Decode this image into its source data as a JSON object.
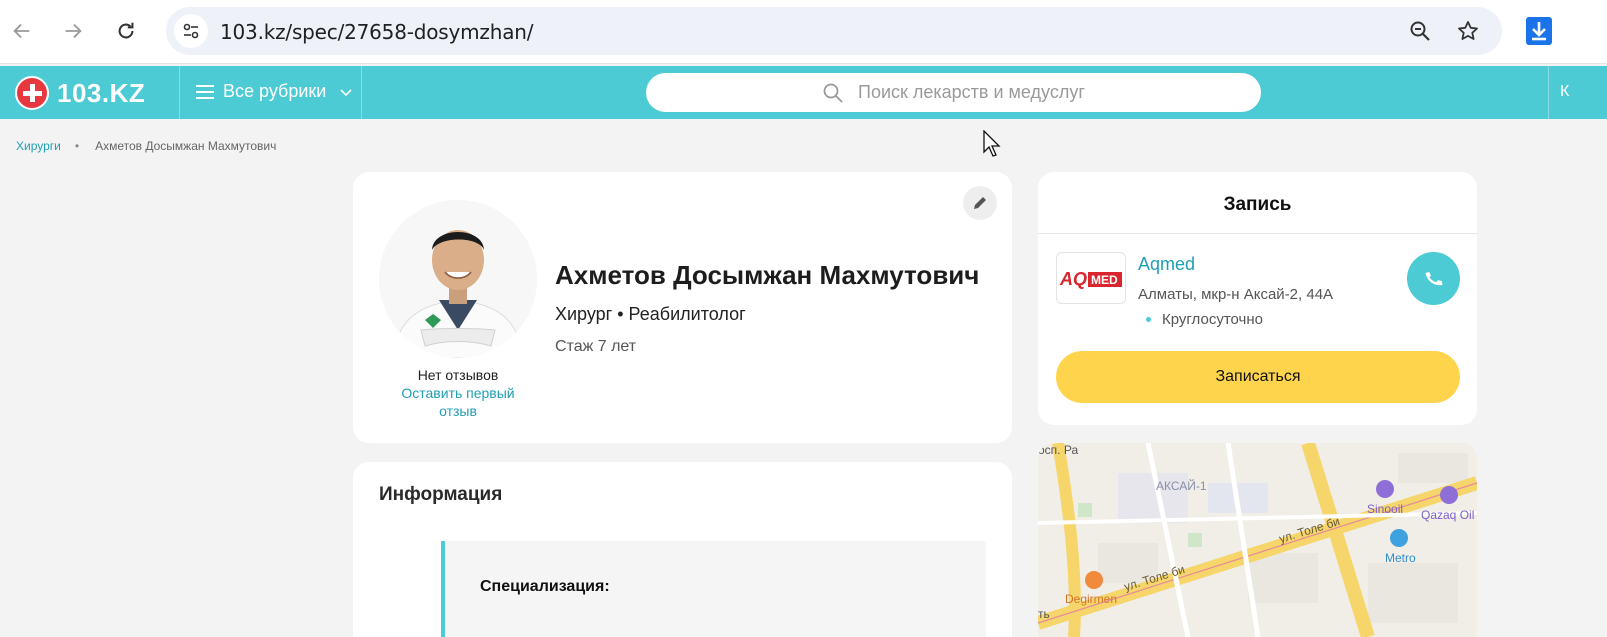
{
  "browser": {
    "url": "103.kz/spec/27658-dosymzhan/"
  },
  "header": {
    "logo_text": "103.KZ",
    "rubrics_label": "Все рубрики",
    "search_placeholder": "Поиск лекарств и медуслуг",
    "cut_text": "К"
  },
  "breadcrumb": {
    "parent": "Хирурги",
    "current": "Ахметов Досымжан Махмутович"
  },
  "doctor": {
    "name": "Ахметов Досымжан Махмутович",
    "specialties": "Хирург • Реабилитолог",
    "experience": "Стаж 7 лет",
    "no_reviews": "Нет отзывов",
    "leave_review": "Оставить первый отзыв"
  },
  "info": {
    "title": "Информация",
    "specialization_label": "Специализация:"
  },
  "booking": {
    "title": "Запись",
    "clinic_logo_text": "AQMED",
    "clinic_name": "Aqmed",
    "address": "Алматы, мкр-н Аксай-2, 44А",
    "hours": "Круглосуточно",
    "book_button": "Записаться"
  },
  "map": {
    "labels": {
      "district": "АКСАЙ-1",
      "street1": "ул. Толе би",
      "street2": "ул. Толе би",
      "poi_sinooil": "Sinooil",
      "poi_qazaq": "Qazaq Oil",
      "poi_metro": "Metro",
      "poi_degirmen": "Degirmen",
      "corner_top": "осп. Ра",
      "corner_bottom": "ть"
    }
  },
  "colors": {
    "brand_teal": "#4ccbd5",
    "link_teal": "#1f9fb3",
    "book_yellow": "#ffd44d",
    "logo_red": "#e8383f"
  }
}
